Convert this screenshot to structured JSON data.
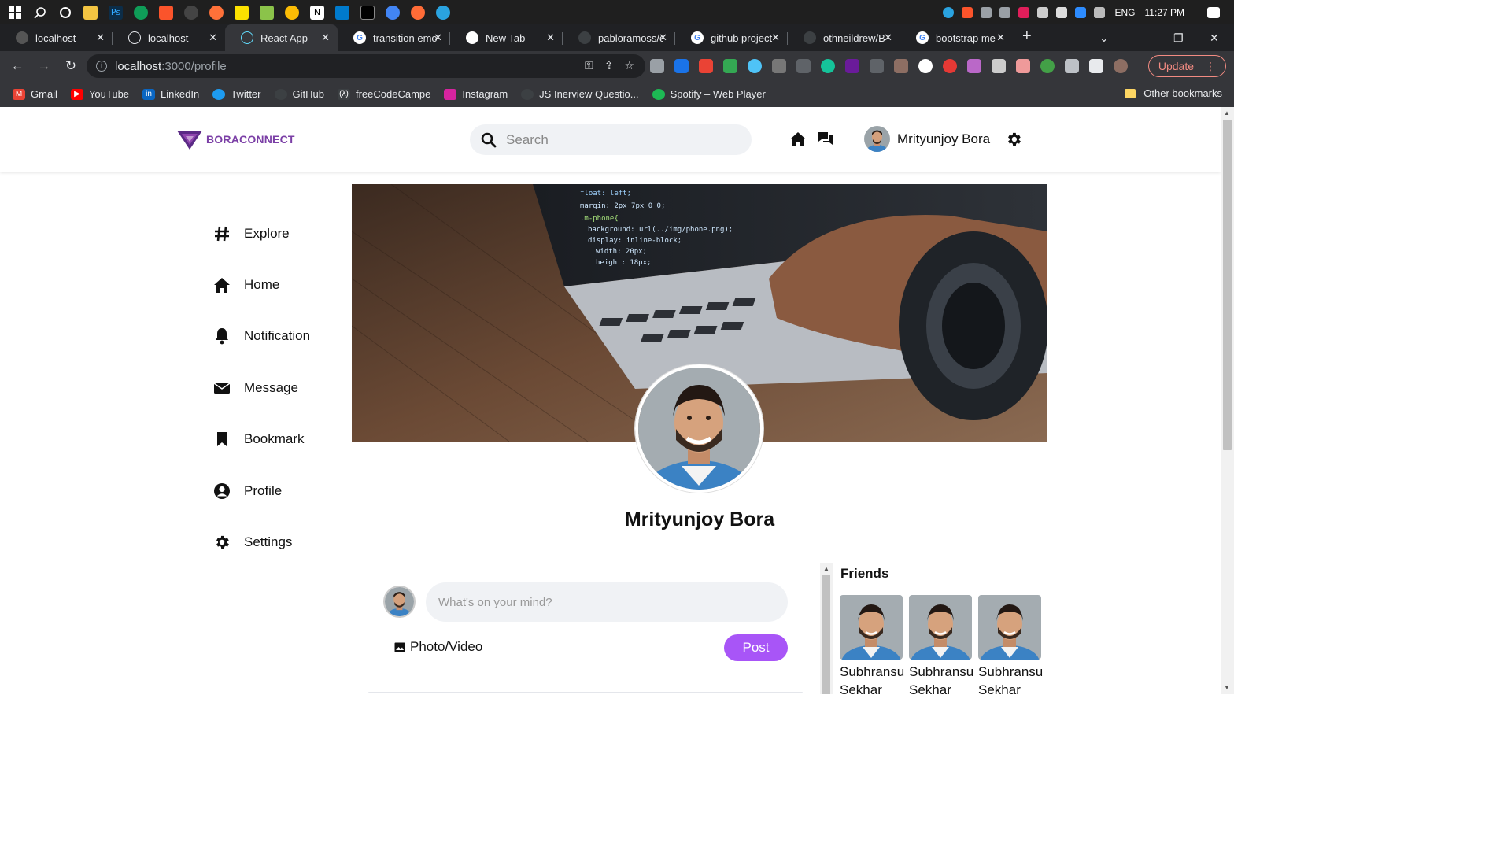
{
  "os": {
    "taskbar": {
      "time": "11:27 PM",
      "language": "ENG"
    }
  },
  "browser": {
    "tabs": [
      {
        "title": "localhost",
        "active": false
      },
      {
        "title": "localhost",
        "active": false
      },
      {
        "title": "React App",
        "active": true
      },
      {
        "title": "transition emo",
        "active": false
      },
      {
        "title": "New Tab",
        "active": false
      },
      {
        "title": "pabloramoss/c",
        "active": false
      },
      {
        "title": "github project",
        "active": false
      },
      {
        "title": "othneildrew/B",
        "active": false
      },
      {
        "title": "bootstrap me",
        "active": false
      }
    ],
    "url_host": "localhost",
    "url_path": ":3000/profile",
    "update_label": "Update",
    "bookmarks": [
      {
        "label": "Gmail",
        "color": "#ea4335",
        "icon": "gmail-icon"
      },
      {
        "label": "YouTube",
        "color": "#ff0000",
        "icon": "youtube-icon"
      },
      {
        "label": "LinkedIn",
        "color": "#0a66c2",
        "icon": "linkedin-icon"
      },
      {
        "label": "Twitter",
        "color": "#1d9bf0",
        "icon": "twitter-icon"
      },
      {
        "label": "GitHub",
        "color": "#3c4043",
        "icon": "github-icon"
      },
      {
        "label": "freeCodeCampe",
        "color": "#3c4043",
        "icon": "freecodecamp-icon"
      },
      {
        "label": "Instagram",
        "color": "#d6249f",
        "icon": "instagram-icon"
      },
      {
        "label": "JS Inerview Questio...",
        "color": "#3c4043",
        "icon": "github-icon"
      },
      {
        "label": "Spotify – Web Player",
        "color": "#1db954",
        "icon": "spotify-icon"
      }
    ],
    "other_bookmarks": "Other bookmarks"
  },
  "app": {
    "brand": "BORACONNECT",
    "brand_color": "#7b3fa6",
    "accent_color": "#a855f7",
    "search_placeholder": "Search",
    "current_user": "Mrityunjoy Bora",
    "sidebar": [
      {
        "label": "Explore",
        "icon": "hashtag-icon"
      },
      {
        "label": "Home",
        "icon": "home-icon"
      },
      {
        "label": "Notification",
        "icon": "bell-icon"
      },
      {
        "label": "Message",
        "icon": "envelope-icon"
      },
      {
        "label": "Bookmark",
        "icon": "bookmark-icon"
      },
      {
        "label": "Profile",
        "icon": "user-circle-icon"
      },
      {
        "label": "Settings",
        "icon": "gear-icon"
      }
    ],
    "profile": {
      "name": "Mrityunjoy Bora"
    },
    "share": {
      "placeholder": "What's on your mind?",
      "photo_label": "Photo/Video",
      "post_label": "Post"
    },
    "friends": {
      "title": "Friends",
      "list": [
        {
          "name_line1": "Subhransu",
          "name_line2": "Sekhar"
        },
        {
          "name_line1": "Subhransu",
          "name_line2": "Sekhar"
        },
        {
          "name_line1": "Subhransu",
          "name_line2": "Sekhar"
        }
      ]
    }
  }
}
